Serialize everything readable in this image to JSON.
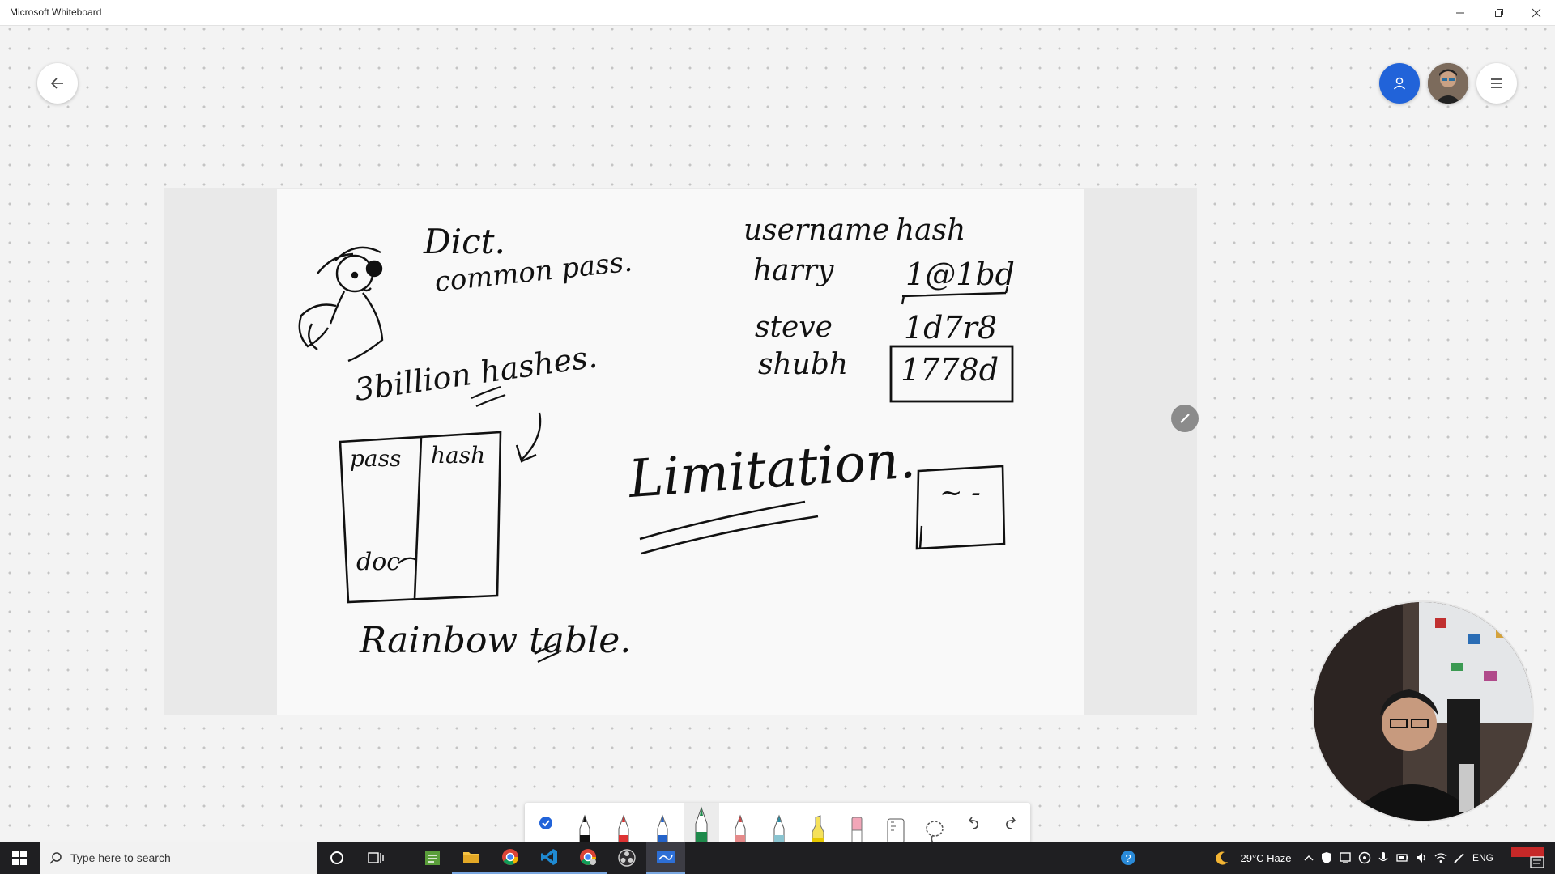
{
  "window": {
    "title": "Microsoft Whiteboard"
  },
  "board": {
    "ink": {
      "dict": "Dict.",
      "common_pass": "common pass.",
      "billion_hashes": "3billion hashes.",
      "table_pass": "pass",
      "table_hash": "hash",
      "table_doc": "doc",
      "rainbow_table": "Rainbow table.",
      "limitation": "Limitation.",
      "username_header": "username",
      "hash_header": "hash",
      "user_1": "harry",
      "user_2": "steve",
      "user_3": "shubh",
      "hash_1": "1@1bd",
      "hash_2": "1d7r8",
      "hash_3": "1778d",
      "box_scribble": "~ -"
    }
  },
  "taskbar": {
    "search_placeholder": "Type here to search",
    "weather": "29°C Haze",
    "language": "ENG"
  },
  "colors": {
    "user_button": "#2163d9",
    "taskbar": "#1f1f22",
    "ink": "#111111"
  }
}
